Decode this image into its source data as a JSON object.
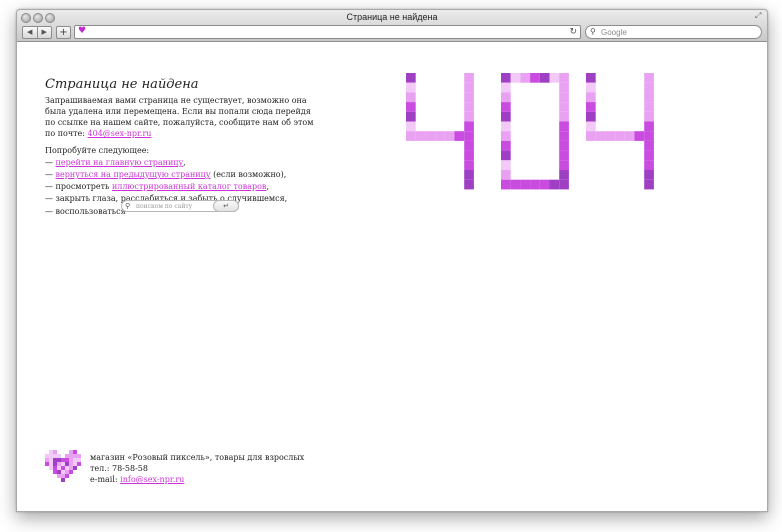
{
  "browser": {
    "title": "Страница не найдена",
    "search_placeholder": "Google"
  },
  "page": {
    "title": "Страница не найдена",
    "intro_text": "Запрашиваемая вами страница не существует, возможно она была удалена или перемещена. Если вы попали сюда перейдя по ссылке на нашем сайте, пожалуйста, сообщите нам об этом по почте: ",
    "intro_email": "404@sex-npr.ru",
    "try_heading": "Попробуйте следующее:",
    "item1_prefix": "— ",
    "item1_link": "перейти на главную страницу",
    "item1_suffix": ",",
    "item2_prefix": "— ",
    "item2_link": "вернуться на предыдущую страницу",
    "item2_suffix": " (если возможно),",
    "item3_prefix": "— просмотреть ",
    "item3_link": "иллюстрированный каталог товаров",
    "item3_suffix": ",",
    "item4_text": "— закрыть глаза, расслабиться и забыть о случившемся,",
    "item5_text": "— воспользоваться",
    "search_placeholder": "поиском по сайту",
    "submit_label": "↵",
    "big_error_code": "404"
  },
  "footer": {
    "line1": "магазин «Розовый пиксель», товары для взрослых",
    "phone": "тел.: 78-58-58",
    "email_label": "e-mail: ",
    "email": "info@sex-npr.ru"
  },
  "colors": {
    "link": "#cc33d6",
    "pixel_dark": "#9e3fc4",
    "pixel_mid": "#c94be0",
    "pixel_light": "#e9a2f2",
    "pixel_pale": "#f3c9f8"
  }
}
